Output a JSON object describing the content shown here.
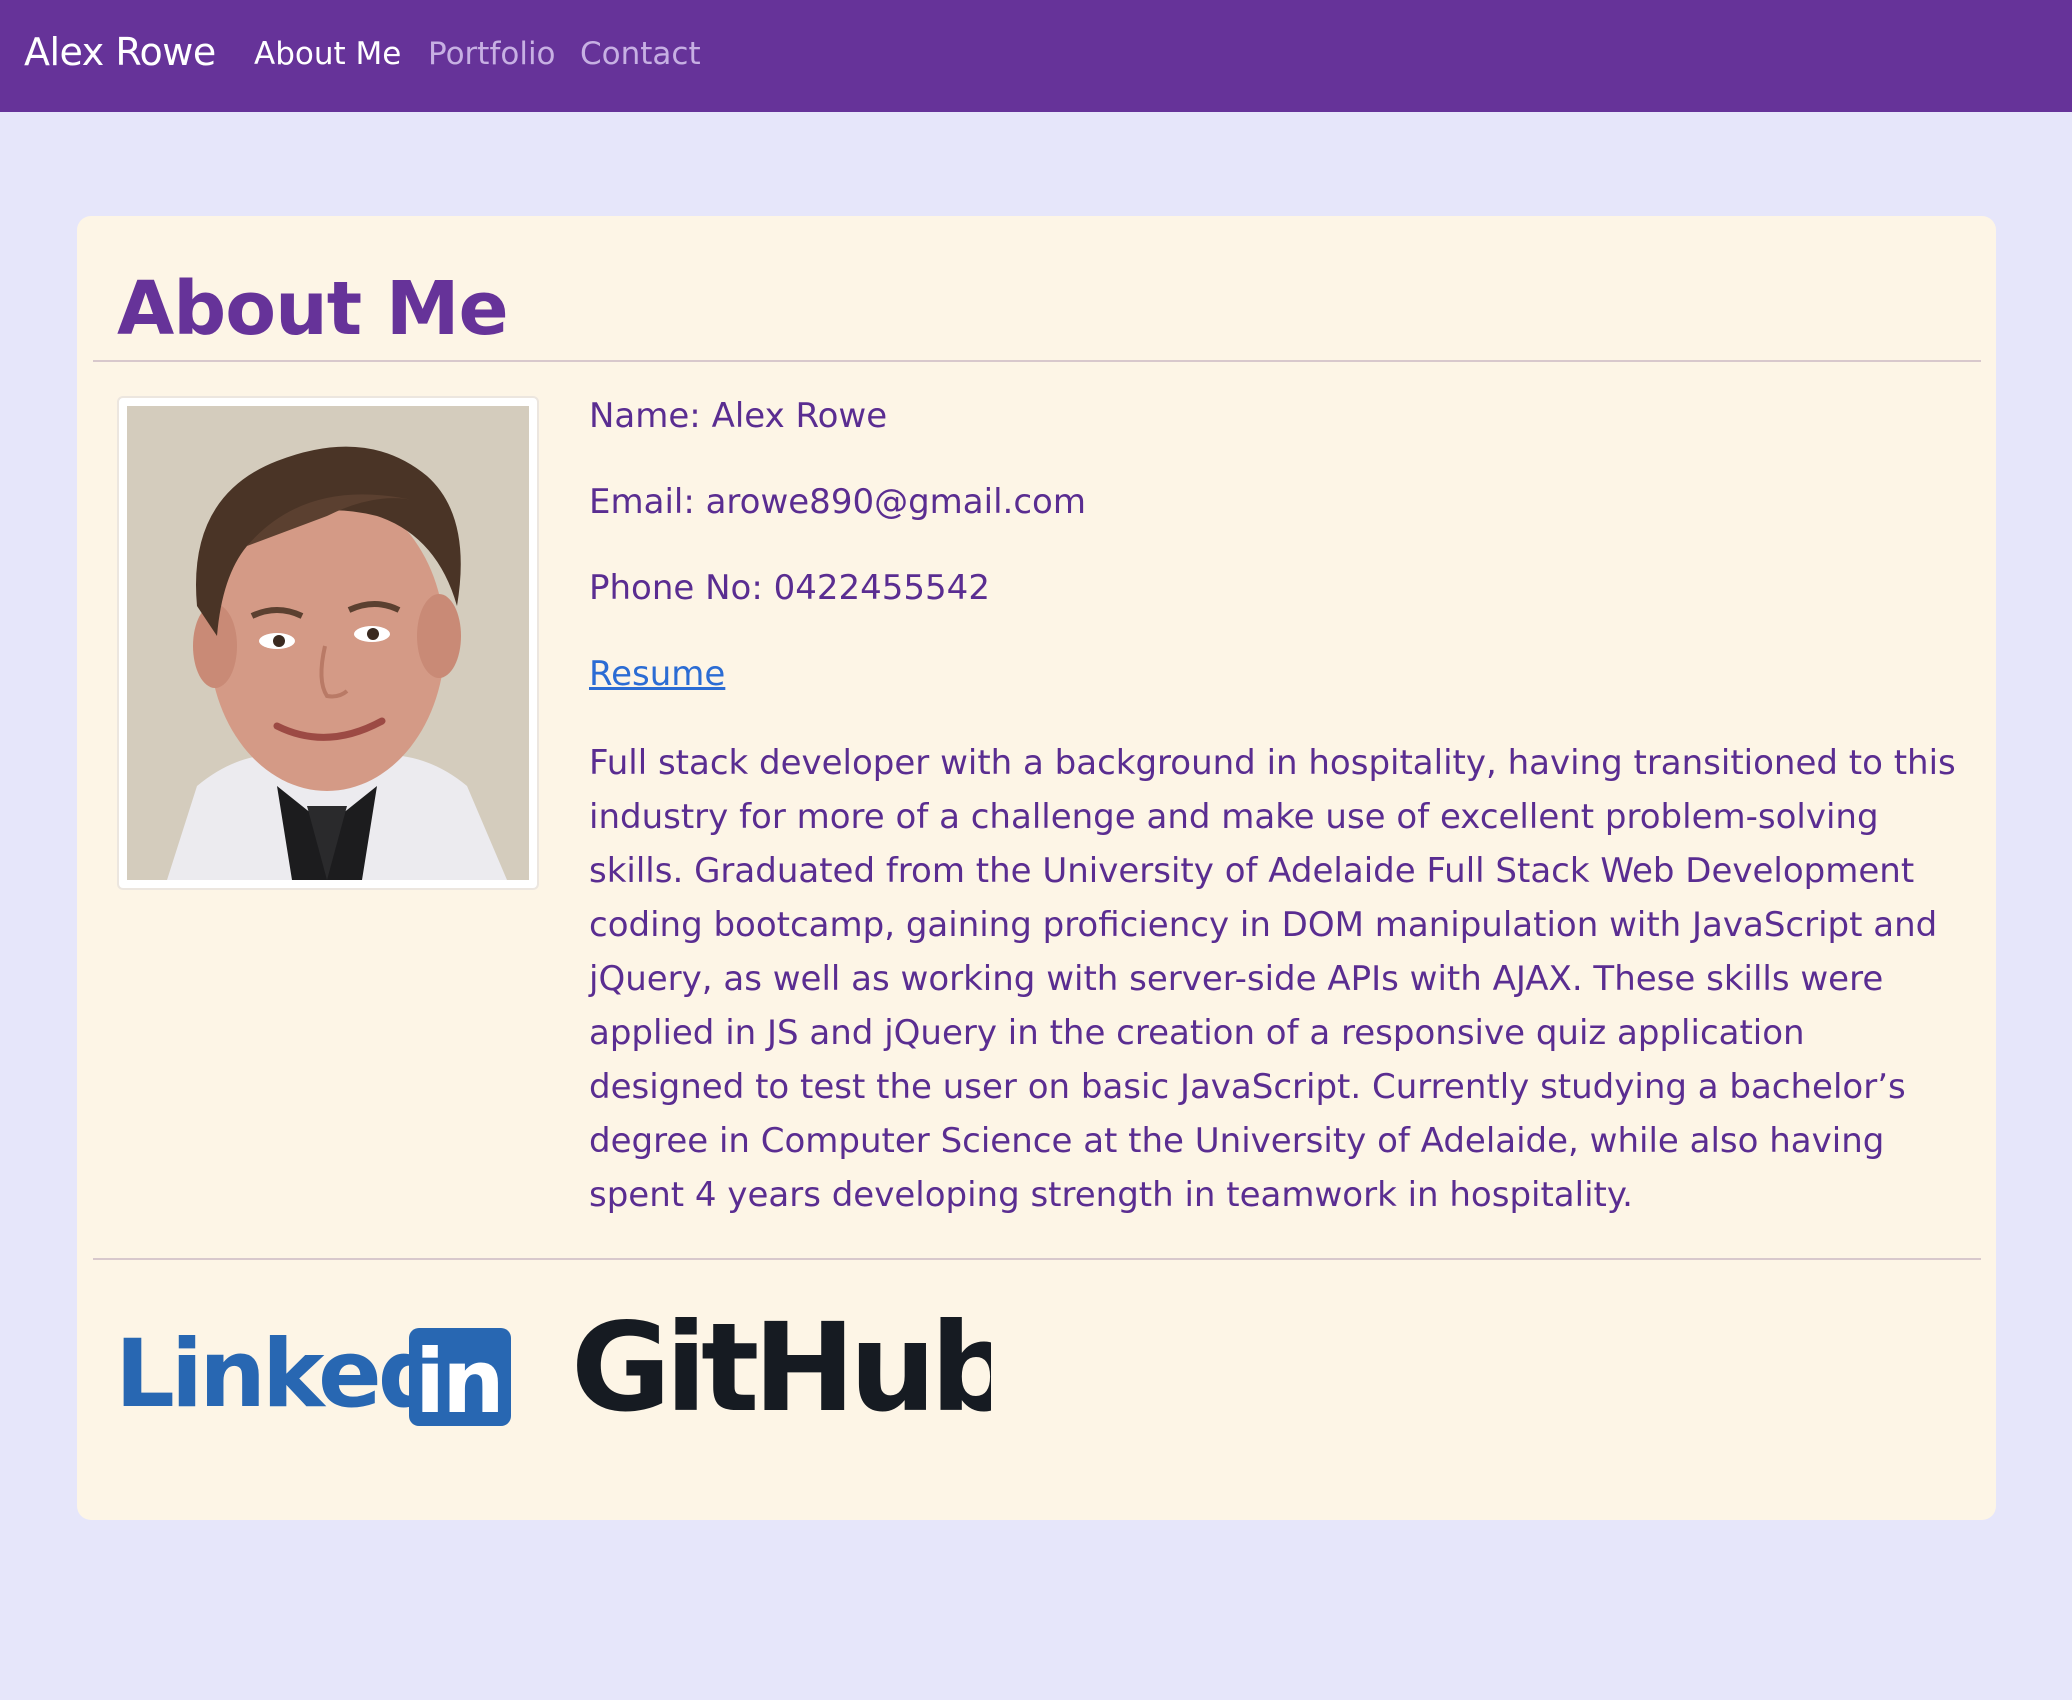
{
  "nav": {
    "brand": "Alex Rowe",
    "links": [
      {
        "label": "About Me",
        "active": true
      },
      {
        "label": "Portfolio",
        "active": false
      },
      {
        "label": "Contact",
        "active": false
      }
    ]
  },
  "main": {
    "title": "About Me",
    "name_line": "Name: Alex Rowe",
    "email_line": "Email: arowe890@gmail.com",
    "phone_line": "Phone No: 0422455542",
    "resume_label": "Resume",
    "bio": "Full stack developer with a background in hospitality, having transitioned to this industry for more of a challenge and make use of excellent problem-solving skills. Graduated from the University of Adelaide Full Stack Web Development coding bootcamp, gaining proficiency in DOM manipulation with JavaScript and jQuery, as well as working with server-side APIs with AJAX. These skills were applied in JS and jQuery in the creation of a responsive quiz application designed to test the user on basic JavaScript. Currently studying a bachelor’s degree in Computer Science at the University of Adelaide, while also having spent 4 years developing strength in teamwork in hospitality."
  },
  "social": {
    "linkedin_logo_text": "Linkedin",
    "github_logo_text": "GitHub"
  },
  "colors": {
    "navbar": "#663399",
    "page_bg": "#e6e6fa",
    "card_bg": "#fdf5e6",
    "accent_text": "#663399",
    "link": "#2b6cd4",
    "linkedin_blue": "#2867b2",
    "github_black": "#161b22"
  }
}
